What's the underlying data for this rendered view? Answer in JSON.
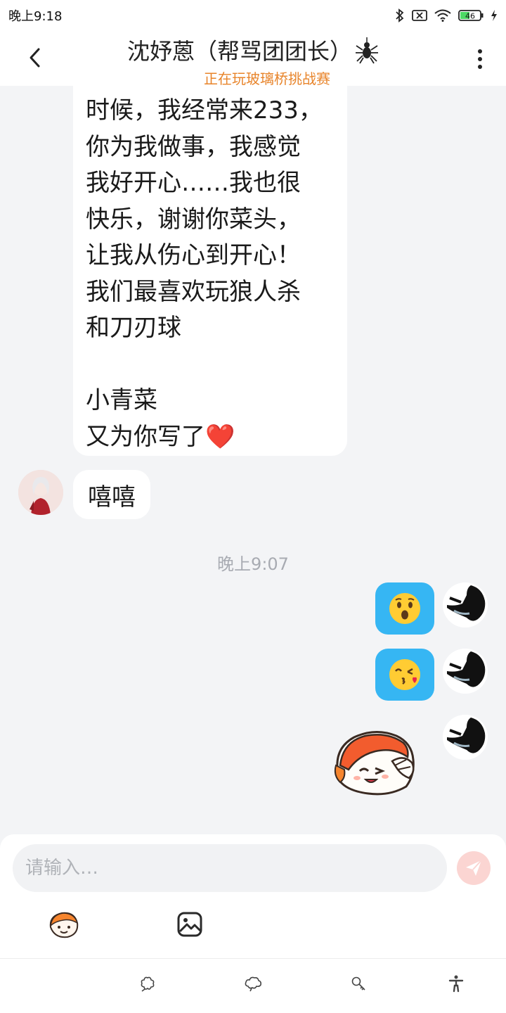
{
  "status_bar": {
    "time": "晚上9:18",
    "battery_level": "46",
    "icons": [
      "bluetooth-icon",
      "sim-off-icon",
      "wifi-icon",
      "battery-icon",
      "charging-icon"
    ]
  },
  "header": {
    "title": "沈妤蒽（帮骂团团长）",
    "subtitle": "正在玩玻璃桥挑战赛",
    "back_icon": "chevron-left-icon",
    "more_icon": "more-vertical-icon",
    "title_badge_icon": "spider-icon"
  },
  "messages": {
    "long_bubble": {
      "lines": [
        "时候，我经常来233，",
        "你为我做事，我感觉",
        "我好开心……我也很",
        "快乐，谢谢你菜头，",
        "让我从伤心到开心！",
        "我们最喜欢玩狼人杀",
        "和刀刃球",
        "",
        "小青菜",
        "又为你写了"
      ],
      "heart_emoji": "❤️"
    },
    "short_bubble": "嘻嘻",
    "timestamp": "晚上9:07",
    "sent": [
      {
        "emoji": "😲",
        "name": "astonished-emoji"
      },
      {
        "emoji": "😘",
        "name": "kissing-heart-emoji"
      }
    ],
    "sticker_name": "cartoon-girl-sticker"
  },
  "composer": {
    "placeholder": "请输入…",
    "send_icon": "paper-plane-icon",
    "tools": [
      "emoji-sticker-icon",
      "image-icon"
    ]
  },
  "tabbar": {
    "tabs": [
      "flower-icon",
      "cloud-icon",
      "key-icon",
      "accessibility-icon"
    ]
  },
  "colors": {
    "accent_orange": "#e8842a",
    "sent_bubble": "#36b6f3",
    "background": "#f3f4f6",
    "heart": "#d3202e",
    "send_button": "#fbd5d2"
  }
}
